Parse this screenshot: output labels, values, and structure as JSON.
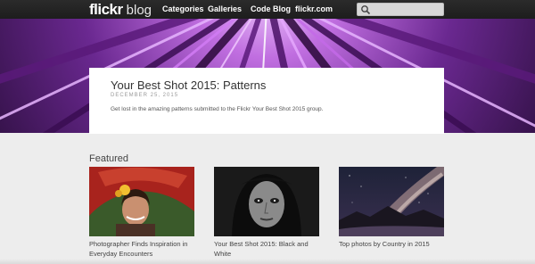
{
  "header": {
    "logo_main": "flickr",
    "logo_sub": "blog",
    "nav": [
      "Categories",
      "Galleries",
      "Code Blog",
      "flickr.com"
    ],
    "search_placeholder": ""
  },
  "post": {
    "title": "Your Best Shot 2015: Patterns",
    "date": "DECEMBER 25, 2015",
    "summary": "Get lost in the amazing patterns submitted to the Flickr Your Best Shot 2015 group."
  },
  "featured": {
    "heading": "Featured",
    "cards": [
      {
        "caption": "Photographer Finds Inspiration in Everyday Encounters",
        "image": "portrait-girl-red-umbrella"
      },
      {
        "caption": "Your Best Shot 2015: Black and White",
        "image": "bw-portrait"
      },
      {
        "caption": "Top photos by Country in 2015",
        "image": "milky-way-landscape"
      }
    ]
  },
  "colors": {
    "topbar": "#222222",
    "accent_purple": "#8a3fb0",
    "page_bg": "#ededed"
  }
}
